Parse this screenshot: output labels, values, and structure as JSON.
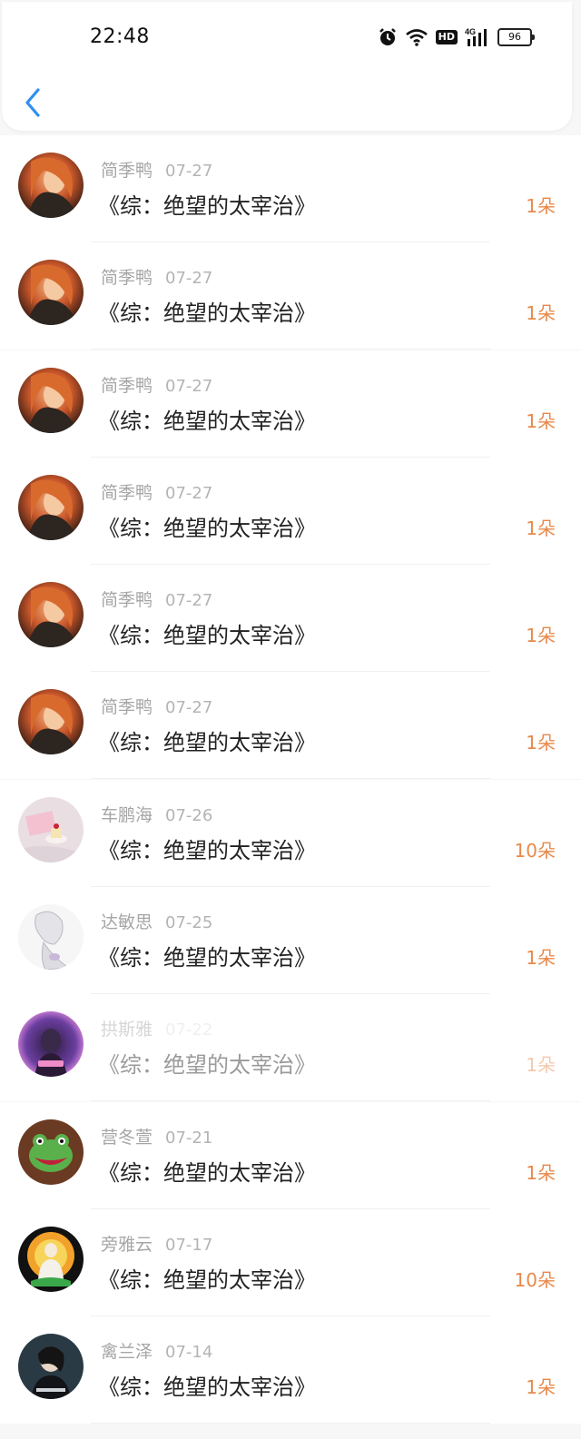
{
  "status_bar": {
    "time": "22:48",
    "network": "4G",
    "hd": "HD",
    "battery": "96",
    "icons": [
      "alarm-icon",
      "wifi-icon",
      "hd-icon",
      "signal-4g-icon",
      "battery-icon"
    ]
  },
  "nav": {
    "back_icon": "chevron-left-icon",
    "accent": "#2f8ff0"
  },
  "colors": {
    "amount": "#e8894a",
    "name": "#a6a6a6",
    "title": "#222222"
  },
  "records": [
    {
      "name": "简季鸭",
      "date": "07-27",
      "book": "《综：绝望的太宰治》",
      "amount": "1朵",
      "avatar": "red-hair-portrait"
    },
    {
      "name": "简季鸭",
      "date": "07-27",
      "book": "《综：绝望的太宰治》",
      "amount": "1朵",
      "avatar": "red-hair-portrait"
    },
    {
      "name": "简季鸭",
      "date": "07-27",
      "book": "《综：绝望的太宰治》",
      "amount": "1朵",
      "avatar": "red-hair-portrait"
    },
    {
      "name": "简季鸭",
      "date": "07-27",
      "book": "《综：绝望的太宰治》",
      "amount": "1朵",
      "avatar": "red-hair-portrait"
    },
    {
      "name": "简季鸭",
      "date": "07-27",
      "book": "《综：绝望的太宰治》",
      "amount": "1朵",
      "avatar": "red-hair-portrait"
    },
    {
      "name": "简季鸭",
      "date": "07-27",
      "book": "《综：绝望的太宰治》",
      "amount": "1朵",
      "avatar": "red-hair-portrait"
    },
    {
      "name": "车鹏海",
      "date": "07-26",
      "book": "《综：绝望的太宰治》",
      "amount": "10朵",
      "avatar": "dessert-photo"
    },
    {
      "name": "达敏思",
      "date": "07-25",
      "book": "《综：绝望的太宰治》",
      "amount": "1朵",
      "avatar": "sketch-girl"
    },
    {
      "name": "拱斯雅",
      "date": "07-22",
      "book": "《综：绝望的太宰治》",
      "amount": "1朵",
      "avatar": "purple-glow-portrait"
    },
    {
      "name": "营冬萱",
      "date": "07-21",
      "book": "《综：绝望的太宰治》",
      "amount": "1朵",
      "avatar": "frog-face"
    },
    {
      "name": "旁雅云",
      "date": "07-17",
      "book": "《综：绝望的太宰治》",
      "amount": "10朵",
      "avatar": "buddha-figure"
    },
    {
      "name": "禽兰泽",
      "date": "07-14",
      "book": "《综：绝望的太宰治》",
      "amount": "1朵",
      "avatar": "dark-portrait"
    }
  ]
}
